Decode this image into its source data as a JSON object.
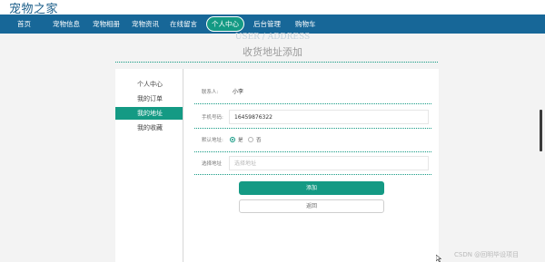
{
  "site": {
    "title": "宠物之家"
  },
  "nav": {
    "items": [
      {
        "label": "首页"
      },
      {
        "label": "宠物信息"
      },
      {
        "label": "宠物相册"
      },
      {
        "label": "宠物资讯"
      },
      {
        "label": "在线留言"
      },
      {
        "label": "个人中心",
        "active": true
      },
      {
        "label": "后台管理"
      },
      {
        "label": "购物车"
      }
    ]
  },
  "heading": {
    "en": "USER / ADDRESS",
    "cn": "收货地址添加"
  },
  "sidebar": {
    "items": [
      {
        "label": "个人中心"
      },
      {
        "label": "我的订单"
      },
      {
        "label": "我的地址",
        "active": true
      },
      {
        "label": "我的收藏"
      }
    ]
  },
  "form": {
    "contact": {
      "label": "联系人:",
      "value": "小李"
    },
    "phone": {
      "label": "手机号码:",
      "value": "16459876322"
    },
    "default": {
      "label": "默认地址:",
      "options": [
        "是",
        "否"
      ],
      "selected": "是"
    },
    "address": {
      "label": "选择地址",
      "placeholder": "选择地址"
    },
    "submit_label": "添加",
    "back_label": "返回"
  },
  "watermark": "CSDN @回明毕设项目",
  "colors": {
    "nav_bg": "#176798",
    "accent": "#149a84"
  },
  "icons": {
    "radio": "radio-button-icon",
    "cursor": "mouse-pointer-icon"
  }
}
